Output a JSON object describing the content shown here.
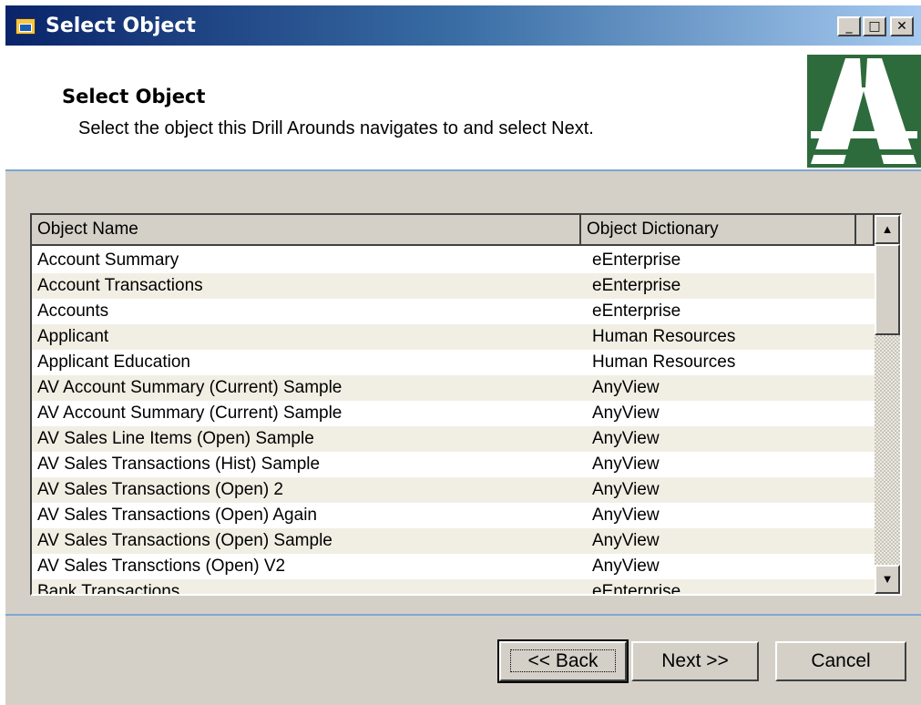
{
  "window": {
    "title": "Select Object",
    "controls": {
      "minimize": "_",
      "maximize": "□",
      "close": "✕"
    }
  },
  "header": {
    "title": "Select Object",
    "subtitle": "Select the object this Drill Arounds navigates to and select Next."
  },
  "list": {
    "columns": [
      "Object Name",
      "Object Dictionary"
    ],
    "rows": [
      {
        "name": "Account Summary",
        "dict": "eEnterprise"
      },
      {
        "name": "Account Transactions",
        "dict": "eEnterprise"
      },
      {
        "name": "Accounts",
        "dict": "eEnterprise"
      },
      {
        "name": "Applicant",
        "dict": "Human Resources"
      },
      {
        "name": "Applicant Education",
        "dict": "Human Resources"
      },
      {
        "name": "AV Account Summary (Current) Sample",
        "dict": "AnyView"
      },
      {
        "name": "AV Account Summary (Current) Sample",
        "dict": "AnyView"
      },
      {
        "name": "AV Sales Line Items (Open) Sample",
        "dict": "AnyView"
      },
      {
        "name": "AV Sales Transactions (Hist) Sample",
        "dict": "AnyView"
      },
      {
        "name": "AV Sales Transactions (Open) 2",
        "dict": "AnyView"
      },
      {
        "name": "AV Sales Transactions (Open) Again",
        "dict": "AnyView"
      },
      {
        "name": "AV Sales Transactions (Open) Sample",
        "dict": "AnyView"
      },
      {
        "name": "AV Sales Transctions (Open) V2",
        "dict": "AnyView"
      },
      {
        "name": "Bank Transactions",
        "dict": "eEnterprise"
      }
    ],
    "scroll_up": "▲",
    "scroll_down": "▼"
  },
  "buttons": {
    "back": "<< Back",
    "next": "Next >>",
    "cancel": "Cancel"
  },
  "colors": {
    "title_gradient_start": "#0a246a",
    "logo_green": "#2e6b3c",
    "separator_blue": "#7ea6d1"
  }
}
